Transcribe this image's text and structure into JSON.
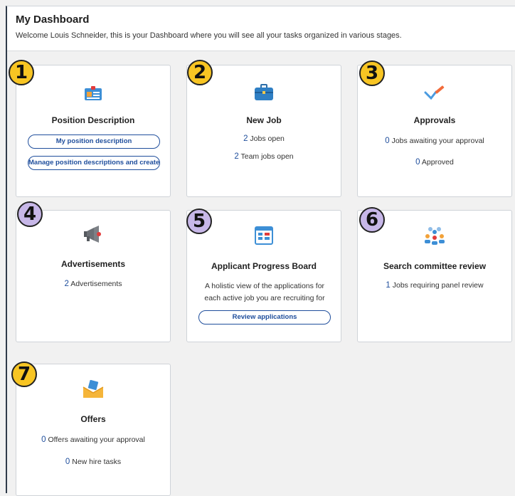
{
  "header": {
    "title": "My Dashboard",
    "subtitle": "Welcome Louis Schneider, this is your Dashboard where you will see all your tasks organized in various stages."
  },
  "colors": {
    "accent": "#1f4e9c",
    "badge_yellow": "#f8c523",
    "badge_purple": "#c7b7e8"
  },
  "cards": {
    "position": {
      "badge": "1",
      "icon": "id-card-icon",
      "title": "Position Description",
      "buttons": [
        "My position description",
        "Manage position descriptions and create..."
      ]
    },
    "newjob": {
      "badge": "2",
      "icon": "briefcase-icon",
      "title": "New Job",
      "lines": [
        {
          "num": "2",
          "text": "Jobs open"
        },
        {
          "num": "2",
          "text": "Team jobs open"
        }
      ]
    },
    "approvals": {
      "badge": "3",
      "icon": "checkmark-pen-icon",
      "title": "Approvals",
      "lines": [
        {
          "num": "0",
          "text": "Jobs awaiting your approval"
        },
        {
          "num": "0",
          "text": "Approved"
        }
      ]
    },
    "ads": {
      "badge": "4",
      "icon": "megaphone-icon",
      "title": "Advertisements",
      "lines": [
        {
          "num": "2",
          "text": "Advertisements"
        }
      ]
    },
    "progress": {
      "badge": "5",
      "icon": "kanban-board-icon",
      "title": "Applicant Progress Board",
      "desc": "A holistic view of the applications for each active job you are recruiting for",
      "button": "Review applications"
    },
    "committee": {
      "badge": "6",
      "icon": "committee-people-icon",
      "title": "Search committee review",
      "lines": [
        {
          "num": "1",
          "text": "Jobs requiring panel review"
        }
      ]
    },
    "offers": {
      "badge": "7",
      "icon": "envelope-icon",
      "title": "Offers",
      "lines": [
        {
          "num": "0",
          "text": "Offers awaiting your approval"
        },
        {
          "num": "0",
          "text": "New hire tasks"
        }
      ]
    }
  }
}
